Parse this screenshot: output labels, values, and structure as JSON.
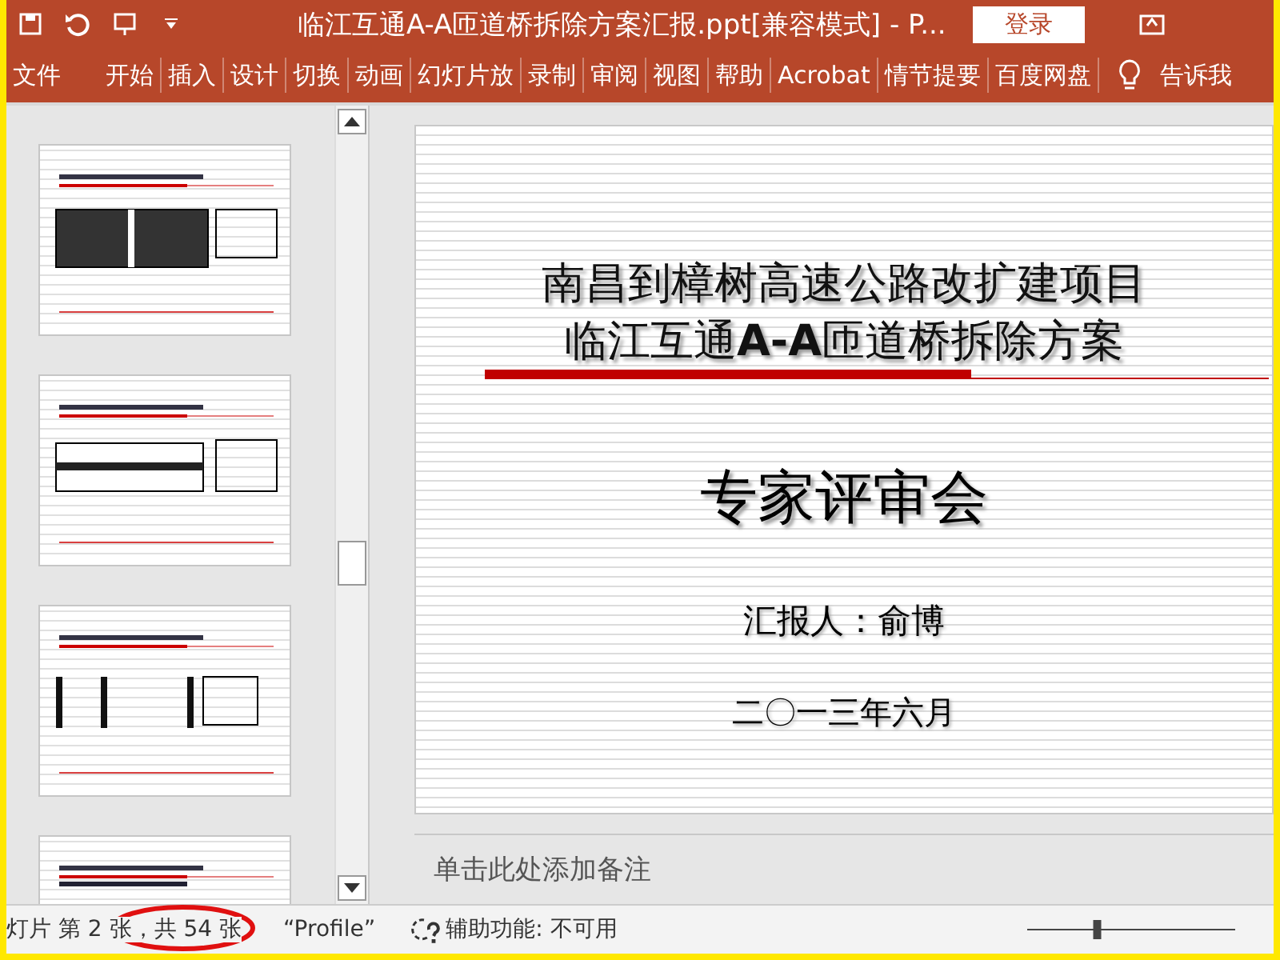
{
  "window": {
    "title": "临江互通A-A匝道桥拆除方案汇报.ppt[兼容模式]  -  P...",
    "sign_in": "登录"
  },
  "ribbon_tabs": [
    {
      "label": "文件"
    },
    {
      "label": "开始"
    },
    {
      "label": "插入"
    },
    {
      "label": "设计"
    },
    {
      "label": "切换"
    },
    {
      "label": "动画"
    },
    {
      "label": "幻灯片放"
    },
    {
      "label": "录制"
    },
    {
      "label": "审阅"
    },
    {
      "label": "视图"
    },
    {
      "label": "帮助"
    },
    {
      "label": "Acrobat"
    },
    {
      "label": "情节提要"
    },
    {
      "label": "百度网盘"
    }
  ],
  "tell_me": "告诉我",
  "thumbnails": [
    {
      "kind": "plan"
    },
    {
      "kind": "section"
    },
    {
      "kind": "piers"
    },
    {
      "kind": "text"
    }
  ],
  "slide": {
    "title_lines": [
      "南昌到樟树高速公路改扩建项目",
      "临江互通**A-A**匝道桥拆除方案"
    ],
    "subtitle": "专家评审会",
    "presenter": "汇报人：俞博",
    "date": "二〇一三年六月"
  },
  "notes": {
    "prompt": "单击此处添加备注"
  },
  "status_bar": {
    "slide_counter": "灯片 第 2 张，共 54 张",
    "theme": "“Profile”",
    "accessibility": "辅助功能: 不可用",
    "zoom": {
      "level": 0.33
    }
  }
}
